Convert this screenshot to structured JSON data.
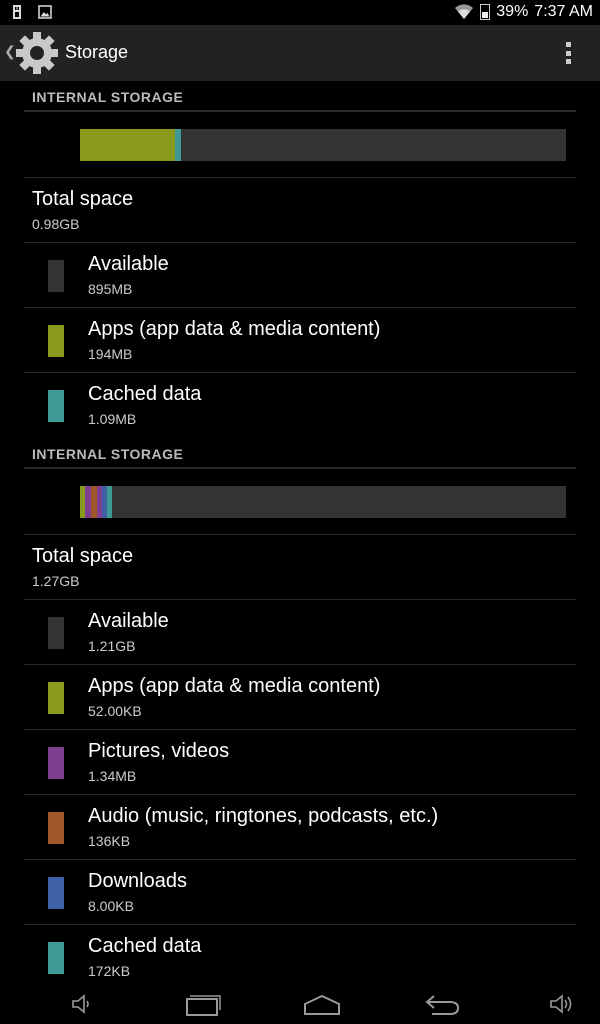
{
  "status_bar": {
    "battery": "39%",
    "time": "7:37 AM",
    "icons": [
      "sd-card-icon",
      "image-notification-icon",
      "wifi-icon",
      "battery-icon"
    ]
  },
  "action_bar": {
    "title": "Storage",
    "icon": "settings-gear-icon"
  },
  "sections": [
    {
      "header": "INTERNAL STORAGE",
      "bar": [
        {
          "color": "#8a9a1e",
          "fraction": 0.195
        },
        {
          "color": "#3f9a96",
          "fraction": 0.012
        }
      ],
      "total_title": "Total space",
      "total_value": "0.98GB",
      "items": [
        {
          "title": "Available",
          "value": "895MB",
          "color": "#333333"
        },
        {
          "title": "Apps (app data & media content)",
          "value": "194MB",
          "color": "#8a9a1e"
        },
        {
          "title": "Cached data",
          "value": "1.09MB",
          "color": "#3f9a96"
        }
      ]
    },
    {
      "header": "INTERNAL STORAGE",
      "bar": [
        {
          "color": "#8a9a1e",
          "fraction": 0.01
        },
        {
          "color": "#7d3f8e",
          "fraction": 0.012
        },
        {
          "color": "#a0582a",
          "fraction": 0.012
        },
        {
          "color": "#7d3f8e",
          "fraction": 0.012
        },
        {
          "color": "#3f5fa6",
          "fraction": 0.01
        },
        {
          "color": "#3f9a96",
          "fraction": 0.01
        }
      ],
      "total_title": "Total space",
      "total_value": "1.27GB",
      "items": [
        {
          "title": "Available",
          "value": "1.21GB",
          "color": "#333333"
        },
        {
          "title": "Apps (app data & media content)",
          "value": "52.00KB",
          "color": "#8a9a1e"
        },
        {
          "title": "Pictures, videos",
          "value": "1.34MB",
          "color": "#7d3f8e"
        },
        {
          "title": "Audio (music, ringtones, podcasts, etc.)",
          "value": "136KB",
          "color": "#a0582a"
        },
        {
          "title": "Downloads",
          "value": "8.00KB",
          "color": "#3f5fa6"
        },
        {
          "title": "Cached data",
          "value": "172KB",
          "color": "#3f9a96"
        }
      ]
    }
  ],
  "nav_bar": {
    "buttons": [
      "volume-down-icon",
      "recent-apps-icon",
      "home-icon",
      "back-icon",
      "volume-up-icon"
    ]
  }
}
